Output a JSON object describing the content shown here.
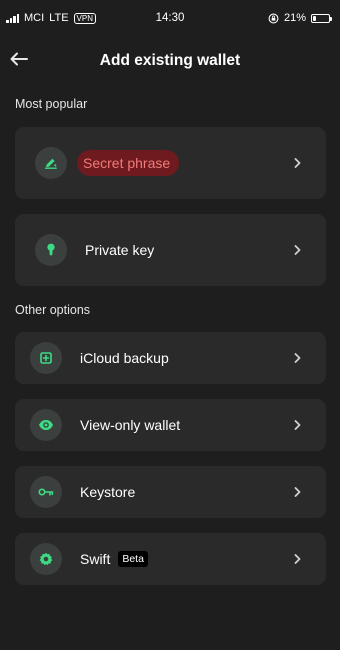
{
  "status_bar": {
    "carrier": "MCI",
    "network": "LTE",
    "vpn": "VPN",
    "time": "14:30",
    "battery_percent": "21%",
    "battery_level": 0.21
  },
  "header": {
    "title": "Add existing wallet"
  },
  "sections": {
    "popular": {
      "title": "Most popular",
      "items": [
        {
          "label": "Secret phrase",
          "icon": "pen-sparkle-icon",
          "highlighted": true
        },
        {
          "label": "Private key",
          "icon": "keyhole-icon"
        }
      ]
    },
    "other": {
      "title": "Other options",
      "items": [
        {
          "label": "iCloud backup",
          "icon": "cloud-backup-icon"
        },
        {
          "label": "View-only wallet",
          "icon": "eye-icon"
        },
        {
          "label": "Keystore",
          "icon": "key-icon"
        },
        {
          "label": "Swift",
          "icon": "swift-badge-icon",
          "badge": "Beta"
        }
      ]
    }
  },
  "colors": {
    "background": "#1e1e1e",
    "card": "#2a2a2a",
    "icon_circle": "#3b3f3d",
    "accent_green": "#3ddc84",
    "highlight_bg": "#6e1a1f",
    "highlight_text": "#f07b7b"
  }
}
